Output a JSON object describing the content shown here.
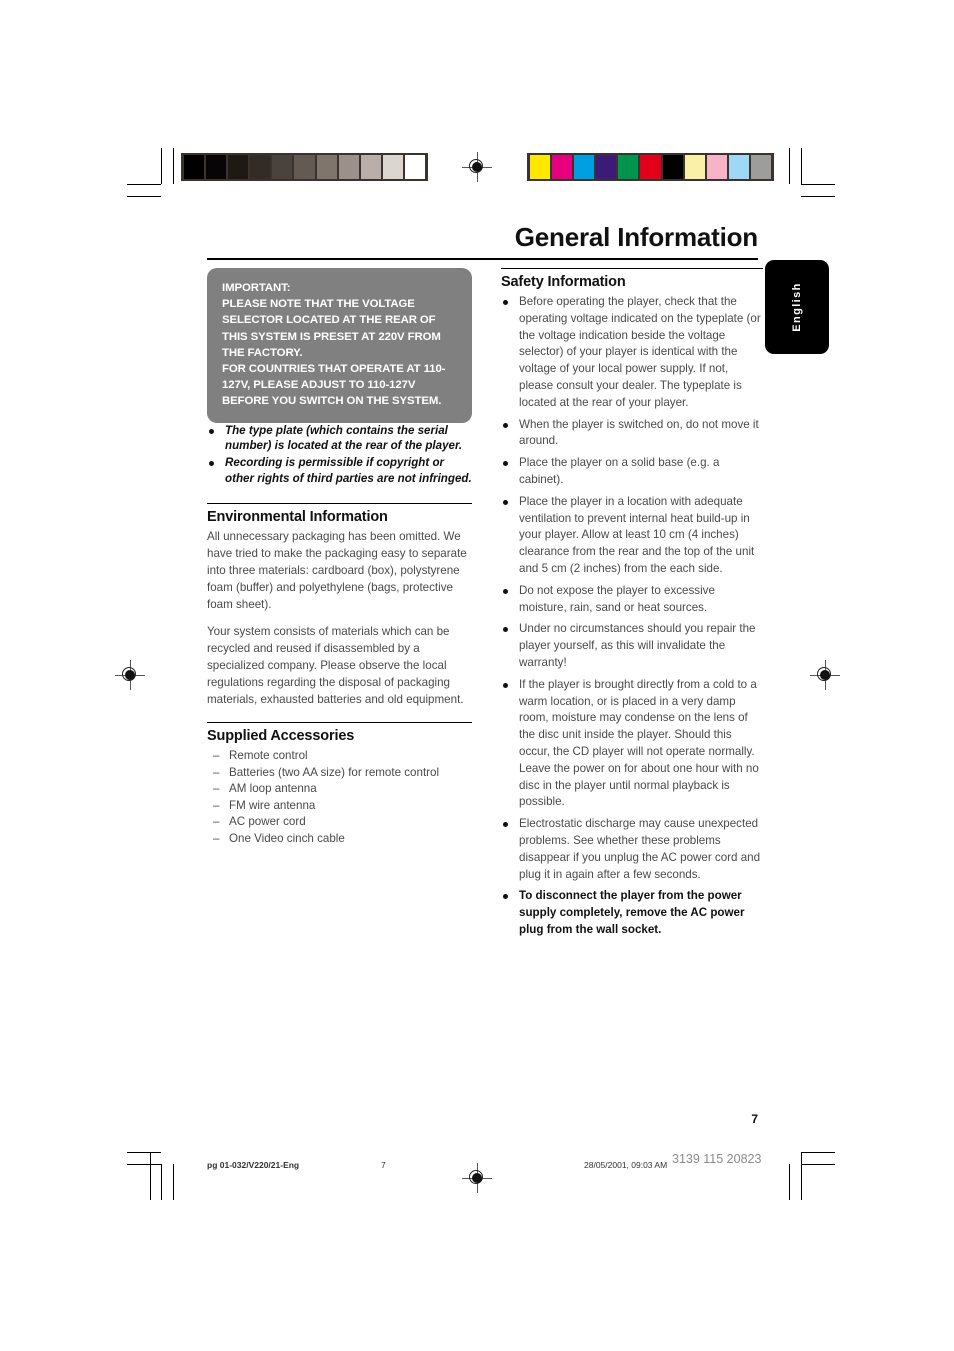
{
  "page": {
    "title": "General Information",
    "folio": "7",
    "language_tab": "English"
  },
  "calibration": {
    "grayscale_swatches": [
      "#000000",
      "#080506",
      "#1e1915",
      "#332b26",
      "#4a423c",
      "#635a53",
      "#80756d",
      "#9b908a",
      "#b9aea8",
      "#dcd6d0",
      "#ffffff"
    ],
    "color_swatches": [
      "#ffe800",
      "#e6007e",
      "#009fe3",
      "#3d1a78",
      "#00954c",
      "#e3001b",
      "#000000",
      "#faf0a8",
      "#f9b3c9",
      "#9ed8f5",
      "#9d9d9c"
    ]
  },
  "callout": {
    "lines": [
      "IMPORTANT:",
      "PLEASE NOTE THAT THE VOLTAGE SELECTOR LOCATED AT THE REAR OF THIS SYSTEM IS PRESET AT 220V FROM THE FACTORY.",
      "FOR COUNTRIES THAT OPERATE AT 110-127V, PLEASE ADJUST TO 110-127V BEFORE YOU SWITCH ON THE SYSTEM."
    ]
  },
  "left_column": {
    "italic_notes": [
      "The type plate (which contains the serial number) is located at the rear of the player.",
      "Recording is permissible if copyright or other rights of third parties are not infringed."
    ],
    "environmental": {
      "heading": "Environmental Information",
      "paragraphs": [
        "All unnecessary packaging has been omitted. We have tried to make the packaging easy to separate into three materials: cardboard (box), polystyrene foam (buffer) and polyethylene (bags, protective foam sheet).",
        "Your system consists of materials which can be recycled and reused if disassembled by a specialized company. Please observe the local regulations regarding the disposal of packaging materials, exhausted batteries and old equipment."
      ]
    },
    "accessories": {
      "heading": "Supplied Accessories",
      "items": [
        "Remote control",
        "Batteries (two AA size) for remote control",
        "AM loop antenna",
        "FM wire antenna",
        "AC power cord",
        "One Video cinch cable"
      ]
    }
  },
  "right_column": {
    "safety": {
      "heading": "Safety Information",
      "items": [
        "Before operating the player, check that the operating voltage indicated on the typeplate (or the voltage indication beside the voltage selector) of your player is identical with the voltage of your local power supply. If not, please consult your dealer. The typeplate is located at the rear of your player.",
        "When the player is switched on, do not move it around.",
        "Place the player on a solid base (e.g. a cabinet).",
        "Place the player in a location with adequate ventilation to prevent internal heat build-up in your player.  Allow at least 10 cm (4 inches) clearance from the rear and the top of the unit and 5 cm (2 inches) from the each side.",
        "Do not expose the player to excessive moisture, rain, sand or heat sources.",
        "Under no circumstances should you repair the player yourself, as this will invalidate the warranty!",
        "If the player is brought directly from a cold to a warm location, or is placed in a very damp room, moisture may condense on the lens of the disc unit inside the player. Should this occur, the CD player will not operate normally. Leave the power on for about one hour with no disc in the player until normal playback is possible.",
        "Electrostatic discharge may cause unexpected problems. See whether these problems disappear if you unplug the AC power cord and plug it in again after a few seconds.",
        "To disconnect the player from the power supply completely, remove the AC power plug from the wall socket."
      ],
      "emphasized_index": 8
    }
  },
  "footer": {
    "file_name": "pg 01-032/V220/21-Eng",
    "page_number": "7",
    "timestamp": "28/05/2001, 09:03 AM",
    "part_number": "3139 115 20823"
  }
}
